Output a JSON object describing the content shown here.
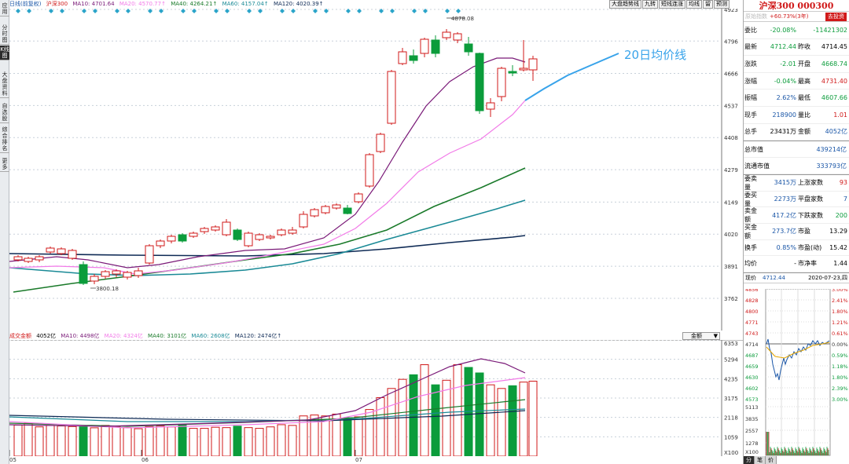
{
  "left_tabs": [
    "应用",
    "分时图",
    "K线图",
    "大盘资料",
    "自选股",
    "综合排名",
    "更多"
  ],
  "header": {
    "period": "日线(前复权)",
    "name": "沪深300",
    "ma10": "MA10: 4701.64",
    "ma20": "MA20: 4570.77↑",
    "ma40": "MA40: 4264.21↑",
    "ma60": "MA60: 4157.04↑",
    "ma120": "MA120: 4020.39↑"
  },
  "toolbar": [
    "大盘趋势线",
    "九转",
    "短线连涨",
    "均线",
    "留",
    "预测"
  ],
  "price_axis": [
    "4923",
    "4796",
    "4666",
    "4537",
    "4408",
    "4279",
    "4149",
    "4020",
    "3891",
    "3762"
  ],
  "annotations": {
    "high": "4878.08",
    "low": "3800.18",
    "legend": "20日均价线"
  },
  "volume_header": {
    "name": "成交金额",
    "v1": "4052亿",
    "ma10": "MA10: 4498亿",
    "ma20": "MA20: 4324亿",
    "ma40": "MA40: 3101亿",
    "ma60": "MA60: 2608亿",
    "ma120": "MA120: 2474亿↑"
  },
  "volume_dropdown": "金额",
  "volume_axis": [
    "6353",
    "5294",
    "4235",
    "3175",
    "2118",
    "1059",
    "X100"
  ],
  "months": [
    "05",
    "06",
    "07"
  ],
  "colors": {
    "up": "#d01919",
    "down": "#0b9c3b",
    "ma10": "#7a1a78",
    "ma20": "#f27be8",
    "ma40": "#1a7a2a",
    "ma60": "#1a8a96",
    "ma120": "#0e2a55",
    "ma_avg": "#38a3ea"
  },
  "right_panel": {
    "title": "沪深300 000300",
    "row1": {
      "label": "原始指数",
      "change": "+60.73%(3年)",
      "button": "去投资"
    },
    "quote": [
      {
        "l1": "委比",
        "v1": "-20.08%",
        "l2": "",
        "v2": "-11421302",
        "c1": "dn",
        "c2": "dn"
      },
      {
        "l1": "最新",
        "v1": "4712.44",
        "l2": "昨收",
        "v2": "4714.45",
        "c1": "dn",
        "c2": ""
      },
      {
        "l1": "涨跌",
        "v1": "-2.01",
        "l2": "开盘",
        "v2": "4668.74",
        "c1": "dn",
        "c2": "dn"
      },
      {
        "l1": "涨幅",
        "v1": "-0.04%",
        "l2": "最高",
        "v2": "4731.40",
        "c1": "dn",
        "c2": "up"
      },
      {
        "l1": "振幅",
        "v1": "2.62%",
        "l2": "最低",
        "v2": "4607.66",
        "c1": "bl",
        "c2": "dn"
      },
      {
        "l1": "现手",
        "v1": "218900",
        "l2": "量比",
        "v2": "1.01",
        "c1": "bl",
        "c2": "up"
      },
      {
        "l1": "总手",
        "v1": "23431万",
        "l2": "金额",
        "v2": "4052亿",
        "c1": "",
        "c2": "bl"
      }
    ],
    "market_value": [
      {
        "label": "总市值",
        "value": "439214亿"
      },
      {
        "label": "流通市值",
        "value": "333793亿"
      }
    ],
    "breadth": [
      {
        "l1": "委卖量",
        "v1": "3415万",
        "l2": "上涨家数",
        "v2": "93",
        "c1": "bl",
        "c2": "up"
      },
      {
        "l1": "委买量",
        "v1": "2273万",
        "l2": "平盘家数",
        "v2": "7",
        "c1": "bl",
        "c2": "bl"
      },
      {
        "l1": "卖金额",
        "v1": "417.2亿",
        "l2": "下跌家数",
        "v2": "200",
        "c1": "bl",
        "c2": "dn"
      },
      {
        "l1": "买金额",
        "v1": "273.7亿",
        "l2": "市盈",
        "v2": "13.29",
        "c1": "bl",
        "c2": ""
      },
      {
        "l1": "换手",
        "v1": "0.85%",
        "l2": "市盈(动)",
        "v2": "15.42",
        "c1": "bl",
        "c2": ""
      },
      {
        "l1": "均价",
        "v1": "-",
        "l2": "市净率",
        "v2": "1.44",
        "c1": "",
        "c2": ""
      }
    ],
    "timeshare": {
      "label": "现价",
      "price": "4712.44",
      "date": "2020-07-23,四",
      "left_axis": [
        "4856",
        "4828",
        "4800",
        "4771",
        "4743",
        "4714",
        "4687",
        "4659",
        "4630",
        "4602",
        "4573"
      ],
      "right_axis": [
        "3.00%",
        "2.41%",
        "1.80%",
        "1.21%",
        "0.61%",
        "0.00%",
        "0.59%",
        "1.18%",
        "1.80%",
        "2.39%",
        "3.00%"
      ],
      "vol_axis": [
        "5113",
        "3835",
        "2557",
        "1278",
        "X100"
      ]
    },
    "bottom_tabs": [
      "分",
      "笔",
      "价"
    ]
  }
}
